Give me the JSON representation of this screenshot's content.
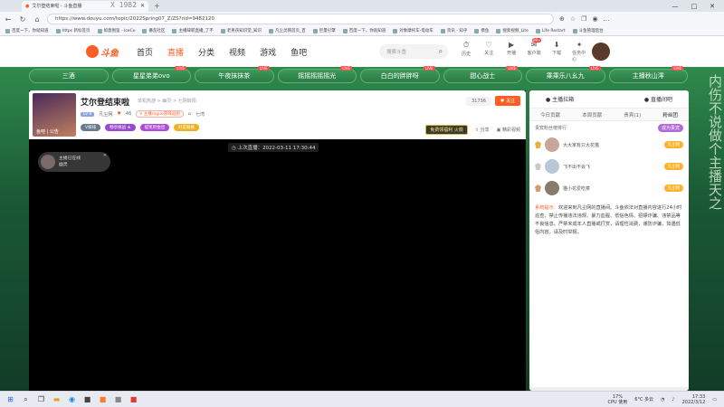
{
  "browser": {
    "tab_title": "艾尔登结束啦 - 斗鱼直播",
    "overlay": "X 1982",
    "url": "https://www.douyu.com/topic/2022Spring07_Z/ZS?rid=9482120",
    "window_controls": [
      "—",
      "□",
      "✕"
    ],
    "bookmarks": [
      "百度一下，你就知道",
      "https 新标签页",
      "如意图鉴 - IceCe",
      "番茄社区",
      "主播辞职直播_了不",
      "老男孩知识堂_知识",
      "凡尘灵网首页_百",
      "巨量引擎",
      "百度一下，你就知道",
      "对象摩托车-电动车",
      "资讯 - 知乎",
      "摸鱼",
      "搜索视频_Lite",
      "Life Restart",
      "斗鱼管理后台"
    ]
  },
  "site": {
    "logo_text": "斗鱼",
    "nav": [
      "首页",
      "直播",
      "分类",
      "视频",
      "游戏",
      "鱼吧"
    ],
    "nav_active": 1,
    "search_placeholder": "搜索斗鱼",
    "header_icons": [
      {
        "name": "history",
        "label": "历史",
        "glyph": "⏱"
      },
      {
        "name": "follow",
        "label": "关注",
        "glyph": "♡"
      },
      {
        "name": "live",
        "label": "开播",
        "glyph": "▶"
      },
      {
        "name": "message",
        "label": "客户端",
        "glyph": "✉"
      },
      {
        "name": "download",
        "label": "下载",
        "glyph": "⬇"
      },
      {
        "name": "task",
        "label": "任务中心",
        "glyph": "✦"
      }
    ],
    "message_badge": "99+"
  },
  "rec_strip": [
    "三酒",
    "星星弟弟ovo",
    "午夜抹抹茶",
    "摇摇摇摇摇光",
    "白白的胖胖呀",
    "甜心战士",
    "乘乘乐八幺九",
    "主播秋山澪"
  ],
  "room": {
    "title": "艾尔登结束啦",
    "category": "单机热游 > 幽灵 > 七阴转阳",
    "thumb_label": "鱼吧  |  公告",
    "level": "LV 8",
    "owner": "凡尘网",
    "fans": "46",
    "chip_label": "V 主播rogue游戏返图",
    "region": "七湾",
    "pill_1": "V排排",
    "pill_2": "畅享挑战 ★",
    "pill_3": "提现到金团",
    "pill_4": "好友联赛",
    "viewer_count": "31736",
    "follow_label": "关注",
    "ad_label": "免费领福利  火箭",
    "share_label": "分享",
    "report_label": "精彩视频",
    "last_live": "上次直播：2022-03-11 17:30:44",
    "anchor_line1": "主播已在线",
    "anchor_line2": "幽灵"
  },
  "right_panel": {
    "top_left": "主播拉箱",
    "top_right": "直播间吧",
    "tabs": [
      "今日贡献",
      "本周贡献",
      "贵宾(1)",
      "粉丝团"
    ],
    "sub_left": "贵宾粉丝榜排行",
    "sub_btn": "成为贵宾",
    "fans": [
      {
        "name": "大大家有只大花猫",
        "tag": "凡尘网"
      },
      {
        "name": "飞不出不会飞",
        "tag": "凡尘网"
      },
      {
        "name": "猫小花爱吃菜",
        "tag": "凡尘网"
      }
    ],
    "notice_head": "系统提示：",
    "notice_body": "欢迎来到凡尘网的直播间。斗鱼依法对直播内容进行24小时巡查，禁止传播违法违规、暴力血腥、低俗色情、招嫖诈骗、违禁品等不良信息。严禁未成年人直播或打赏，请理性消费，谨防诈骗，如遇低俗内容，请及时举报。"
  },
  "side_deco": "内伤不说做个主播天之",
  "taskbar": {
    "cpu_pct": "17%",
    "cpu_label": "CPU 使用",
    "weather": "6°C 多云",
    "time": "17:33",
    "date": "2022/3/12"
  }
}
